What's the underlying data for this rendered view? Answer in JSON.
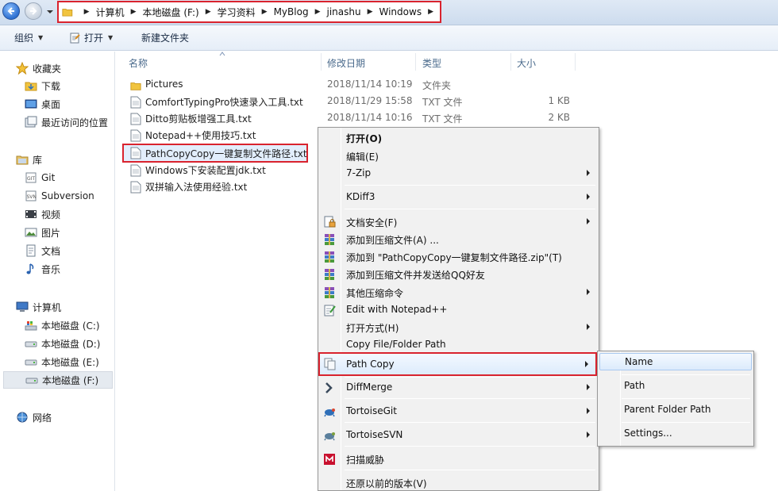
{
  "address": {
    "crumbs": [
      "计算机",
      "本地磁盘 (F:)",
      "学习资料",
      "MyBlog",
      "jinashu",
      "Windows"
    ]
  },
  "toolbar": {
    "organize": "组织",
    "open": "打开",
    "new_folder": "新建文件夹"
  },
  "nav": {
    "favorites": "收藏夹",
    "downloads": "下载",
    "desktop": "桌面",
    "recent": "最近访问的位置",
    "libraries": "库",
    "git": "Git",
    "subversion": "Subversion",
    "videos": "视频",
    "pictures": "图片",
    "documents": "文档",
    "music": "音乐",
    "computer": "计算机",
    "drive_c": "本地磁盘 (C:)",
    "drive_d": "本地磁盘 (D:)",
    "drive_e": "本地磁盘 (E:)",
    "drive_f": "本地磁盘 (F:)",
    "network": "网络"
  },
  "columns": {
    "name": "名称",
    "modified": "修改日期",
    "type": "类型",
    "size": "大小"
  },
  "files": [
    {
      "name": "Pictures",
      "date": "2018/11/14 10:19",
      "type": "文件夹",
      "size": ""
    },
    {
      "name": "ComfortTypingPro快速录入工具.txt",
      "date": "2018/11/29 15:58",
      "type": "TXT 文件",
      "size": "1 KB"
    },
    {
      "name": "Ditto剪贴板增强工具.txt",
      "date": "2018/11/14 10:16",
      "type": "TXT 文件",
      "size": "2 KB"
    },
    {
      "name": "Notepad++使用技巧.txt",
      "date": "",
      "type": "",
      "size": ""
    },
    {
      "name": "PathCopyCopy一键复制文件路径.txt",
      "date": "",
      "type": "",
      "size": ""
    },
    {
      "name": "Windows下安装配置jdk.txt",
      "date": "",
      "type": "",
      "size": ""
    },
    {
      "name": "双拼输入法使用经验.txt",
      "date": "",
      "type": "",
      "size": ""
    }
  ],
  "menu": {
    "open": "打开(O)",
    "edit": "编辑(E)",
    "sevenzip": "7-Zip",
    "kdiff3": "KDiff3",
    "doc_security": "文档安全(F)",
    "add_archive": "添加到压缩文件(A) ...",
    "add_zip": "添加到 \"PathCopyCopy一键复制文件路径.zip\"(T)",
    "add_qq": "添加到压缩文件并发送给QQ好友",
    "other_compress": "其他压缩命令",
    "edit_notepad": "Edit with Notepad++",
    "open_with": "打开方式(H)",
    "copy_path": "Copy File/Folder Path",
    "path_copy": "Path Copy",
    "diffmerge": "DiffMerge",
    "tortoisegit": "TortoiseGit",
    "tortoisesvn": "TortoiseSVN",
    "scan": "扫描威胁",
    "restore": "还原以前的版本(V)"
  },
  "submenu": {
    "name": "Name",
    "path": "Path",
    "parent": "Parent Folder Path",
    "settings": "Settings..."
  }
}
